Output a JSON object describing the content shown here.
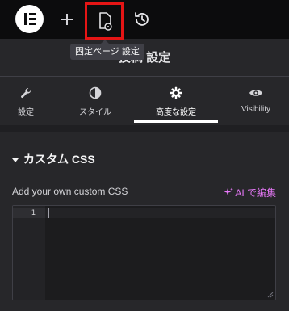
{
  "topbar": {
    "add_label": "+",
    "tooltip": "固定ページ 設定"
  },
  "panel": {
    "title": "投稿 設定"
  },
  "tabs": [
    {
      "label": "設定",
      "icon": "wrench-icon"
    },
    {
      "label": "スタイル",
      "icon": "contrast-icon"
    },
    {
      "label": "高度な設定",
      "icon": "gear-icon",
      "active": true
    },
    {
      "label": "Visibility",
      "icon": "eye-icon"
    }
  ],
  "section": {
    "title": "カスタム CSS",
    "field_label": "Add your own custom CSS",
    "ai_label": "AI で編集"
  },
  "editor": {
    "line_number": "1",
    "value": ""
  },
  "colors": {
    "highlight_box": "#e51515",
    "ai_accent": "#e879f9",
    "topbar_bg": "#0c0c0d",
    "panel_bg": "#27272a"
  }
}
